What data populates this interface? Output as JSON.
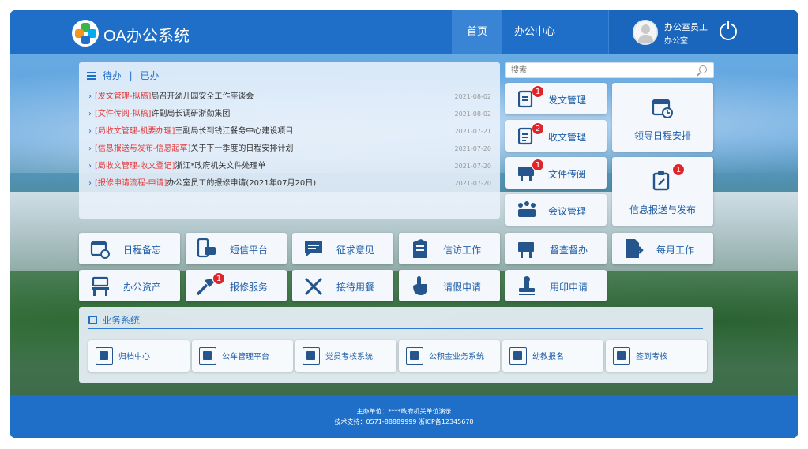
{
  "header": {
    "title": "OA办公系统",
    "nav": {
      "home": "首页",
      "office": "办公中心"
    },
    "user": {
      "name": "办公室员工",
      "dept": "办公室"
    }
  },
  "todo": {
    "tab_todo": "待办",
    "tab_sep": "|",
    "tab_done": "已办",
    "items": [
      {
        "tag": "[发文管理-拟稿]",
        "text": "局召开幼儿园安全工作座谈会",
        "date": "2021-08-02"
      },
      {
        "tag": "[文件传阅-拟稿]",
        "text": "许副局长调研浙勤集团",
        "date": "2021-08-02"
      },
      {
        "tag": "[局收文管理-机要办理]",
        "text": "王副局长到钱江餐务中心建设项目",
        "date": "2021-07-21"
      },
      {
        "tag": "[信息报送与发布-信息起草]",
        "text": "关于下一季度的日程安排计划",
        "date": "2021-07-20"
      },
      {
        "tag": "[局收文管理-收文登记]",
        "text": "浙江*政府机关文件处理单",
        "date": "2021-07-20"
      },
      {
        "tag": "[报修申请流程-申请]",
        "text": "办公室员工的报修申请(2021年07月20日)",
        "date": "2021-07-20"
      }
    ]
  },
  "search": {
    "placeholder": "搜索"
  },
  "right_tiles": {
    "send_doc": {
      "label": "发文管理",
      "badge": "1"
    },
    "recv_doc": {
      "label": "收文管理",
      "badge": "2"
    },
    "circulate": {
      "label": "文件传阅",
      "badge": "1"
    },
    "meeting": {
      "label": "会议管理"
    },
    "schedule": {
      "label": "领导日程安排"
    },
    "info_report": {
      "label": "信息报送与发布",
      "badge": "1"
    }
  },
  "apps_row1": [
    {
      "label": "日程备忘"
    },
    {
      "label": "短信平台"
    },
    {
      "label": "征求意见"
    },
    {
      "label": "信访工作"
    },
    {
      "label": "督查督办"
    },
    {
      "label": "每月工作"
    }
  ],
  "apps_row2": [
    {
      "label": "办公资产"
    },
    {
      "label": "报修服务",
      "badge": "1"
    },
    {
      "label": "接待用餐"
    },
    {
      "label": "请假申请"
    },
    {
      "label": "用印申请"
    }
  ],
  "business": {
    "title": "业务系统",
    "items": [
      {
        "label": "归档中心"
      },
      {
        "label": "公车管理平台"
      },
      {
        "label": "党员考核系统"
      },
      {
        "label": "公积金业务系统"
      },
      {
        "label": "幼教报名"
      },
      {
        "label": "签到考核"
      }
    ]
  },
  "footer": {
    "line1": "主办单位：****政府机关单位演示",
    "line2": "技术支持：0571-88889999 浙ICP备12345678"
  },
  "colors": {
    "primary": "#1f6fc9",
    "icon": "#24558c",
    "badge": "#e0242a",
    "tag": "#e33a3a"
  }
}
